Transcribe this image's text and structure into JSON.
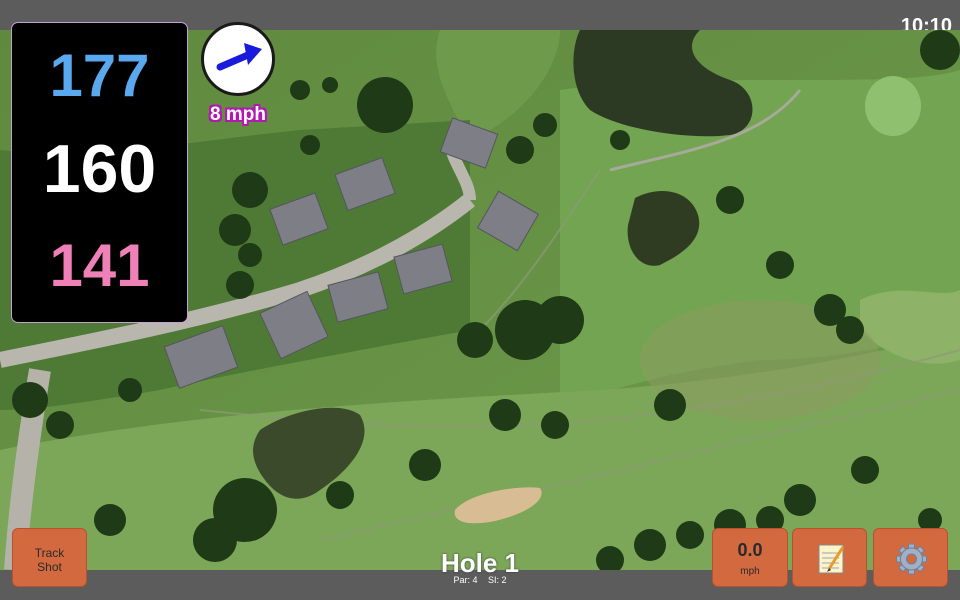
{
  "status_bar": {
    "time": "10:10"
  },
  "yardages": {
    "back": "177",
    "middle": "160",
    "front": "141"
  },
  "wind": {
    "speed_label": "8 mph",
    "direction_icon": "arrow-icon",
    "arrow_color": "#1a1adc"
  },
  "hole": {
    "title": "Hole 1",
    "par_label": "Par: 4",
    "si_label": "SI: 2"
  },
  "buttons": {
    "track_shot": {
      "line1": "Track",
      "line2": "Shot"
    },
    "wind_speed": {
      "value": "0.0",
      "unit": "mph"
    },
    "notes": {
      "icon": "notepad-icon"
    },
    "settings": {
      "icon": "gear-icon"
    }
  },
  "colors": {
    "back_yardage": "#5aa8ee",
    "middle_yardage": "#ffffff",
    "front_yardage": "#f080b8",
    "button": "#d3693f"
  }
}
